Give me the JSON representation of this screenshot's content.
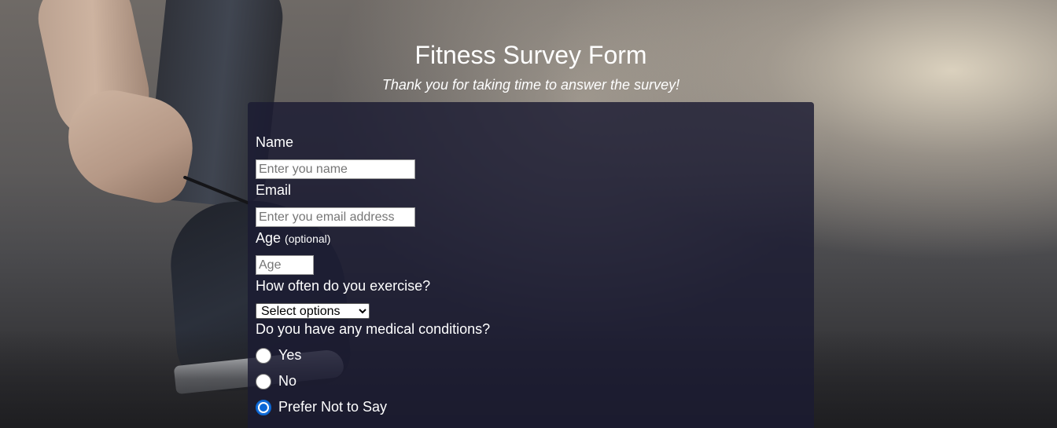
{
  "header": {
    "title": "Fitness Survey Form",
    "subtitle": "Thank you for taking time to answer the survey!"
  },
  "form": {
    "name": {
      "label": "Name",
      "placeholder": "Enter you name",
      "value": ""
    },
    "email": {
      "label": "Email",
      "placeholder": "Enter you email address",
      "value": ""
    },
    "age": {
      "label": "Age",
      "label_note": "(optional)",
      "placeholder": "Age",
      "value": ""
    },
    "exercise": {
      "label": "How often do you exercise?",
      "selected": "Select options"
    },
    "medical": {
      "label": "Do you have any medical conditions?",
      "options": [
        {
          "label": "Yes",
          "checked": false
        },
        {
          "label": "No",
          "checked": false
        },
        {
          "label": "Prefer Not to Say",
          "checked": true
        }
      ]
    }
  },
  "colors": {
    "card_background": "#1b1b32",
    "radio_accent": "#0a67d6",
    "text": "#ffffff"
  }
}
